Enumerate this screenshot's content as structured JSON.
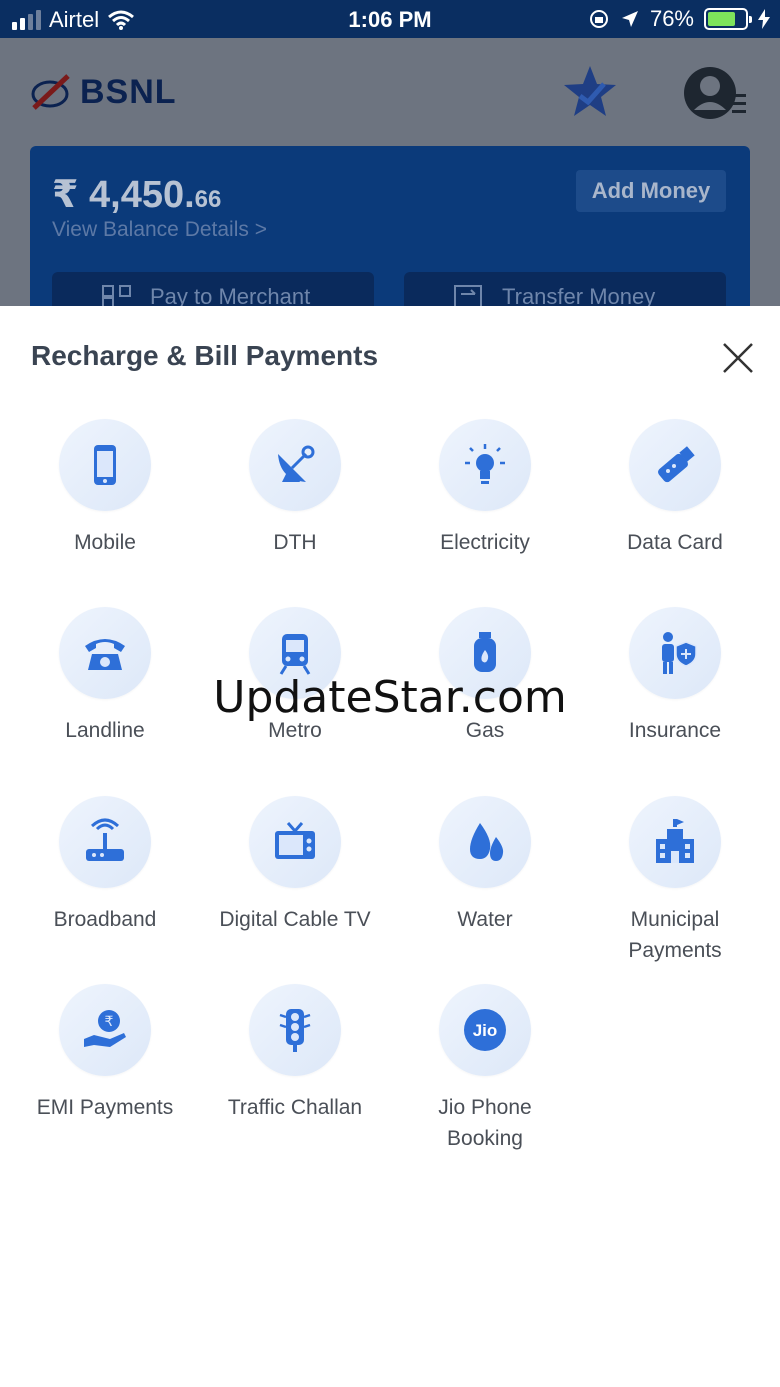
{
  "status_bar": {
    "carrier": "Airtel",
    "time": "1:06 PM",
    "battery": "76%"
  },
  "app": {
    "brand": "BSNL",
    "balance_main": "₹ 4,450.",
    "balance_fraction": "66",
    "balance_link": "View Balance Details >",
    "add_money": "Add Money",
    "pay_merchant": "Pay to Merchant",
    "transfer_money": "Transfer Money"
  },
  "sheet": {
    "title": "Recharge & Bill Payments",
    "items": [
      {
        "label": "Mobile",
        "icon": "mobile-icon"
      },
      {
        "label": "DTH",
        "icon": "satellite-dish-icon"
      },
      {
        "label": "Electricity",
        "icon": "lightbulb-icon"
      },
      {
        "label": "Data Card",
        "icon": "usb-dongle-icon"
      },
      {
        "label": "Landline",
        "icon": "telephone-icon"
      },
      {
        "label": "Metro",
        "icon": "train-icon"
      },
      {
        "label": "Gas",
        "icon": "gas-cylinder-icon"
      },
      {
        "label": "Insurance",
        "icon": "shield-person-icon"
      },
      {
        "label": "Broadband",
        "icon": "router-icon"
      },
      {
        "label": "Digital Cable TV",
        "icon": "tv-icon"
      },
      {
        "label": "Water",
        "icon": "water-drop-icon"
      },
      {
        "label": "Municipal Payments",
        "icon": "municipal-building-icon"
      },
      {
        "label": "EMI Payments",
        "icon": "rupee-hand-icon"
      },
      {
        "label": "Traffic Challan",
        "icon": "traffic-light-icon"
      },
      {
        "label": "Jio Phone Booking",
        "icon": "jio-logo-icon"
      }
    ]
  },
  "watermark": "UpdateStar.com",
  "colors": {
    "icon_blue": "#2e6fd8",
    "status_bar": "#0a2e61",
    "title_text": "#3a4452"
  }
}
